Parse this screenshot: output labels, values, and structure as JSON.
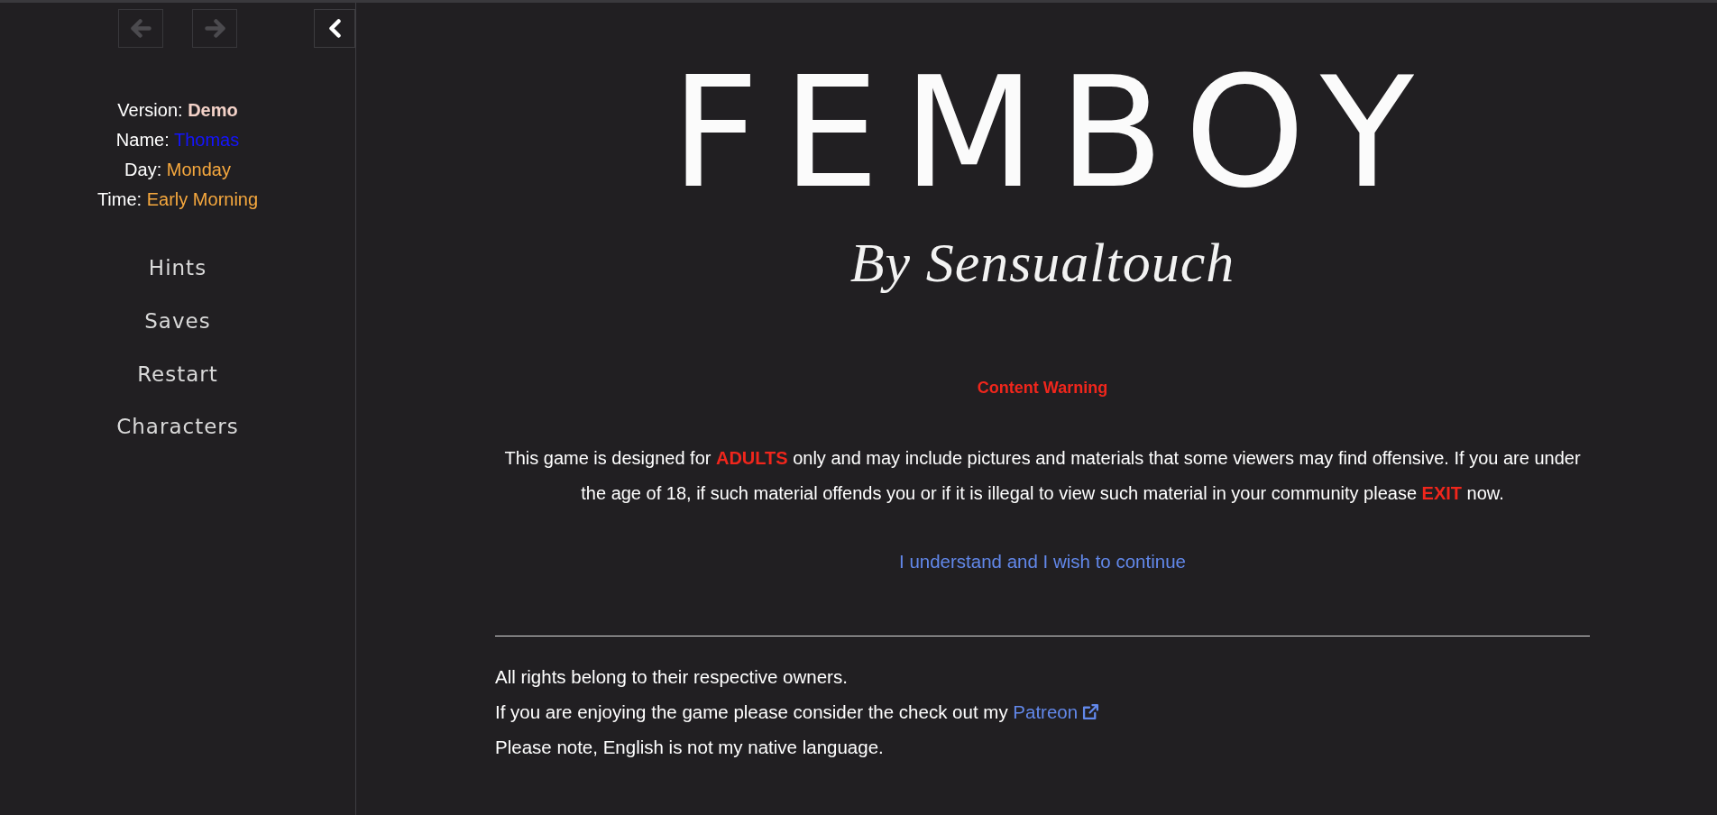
{
  "history_buttons": [
    {
      "kind": "back",
      "disabled": true
    },
    {
      "kind": "forward",
      "disabled": true
    },
    {
      "kind": "collapse",
      "disabled": false
    }
  ],
  "story_caption": [
    {
      "label": "Version:",
      "value": "Demo",
      "color": "#f4d2c8",
      "bold": true
    },
    {
      "label": "Name:",
      "value": "Thomas",
      "color": "#1414ff",
      "bold": false
    },
    {
      "label": "Day:",
      "value": "Monday",
      "color": "#f6a83e",
      "bold": false
    },
    {
      "label": "Time:",
      "value": "Early Morning",
      "color": "#f6a83e",
      "bold": false
    }
  ],
  "menu": [
    "Hints",
    "Saves",
    "Restart",
    "Characters"
  ],
  "logo": {
    "title": "FEMBOY",
    "byline": "By Sensualtouch"
  },
  "warning": {
    "heading": "Content Warning",
    "text": "This game is designed for **ADULTS** only and may include pictures and materials that some viewers may find offensive. If you are under the age of 18, if such material offends you or if it is illegal to view such material in your community please **EXIT** now.",
    "continue_link": "I understand and I wish to continue"
  },
  "footer": [
    {
      "text": "All rights belong to their respective owners."
    },
    {
      "text": "If you are enjoying the game please consider the check out my",
      "link": "Patreon"
    },
    {
      "text": "Please note, English is not my native language."
    }
  ]
}
